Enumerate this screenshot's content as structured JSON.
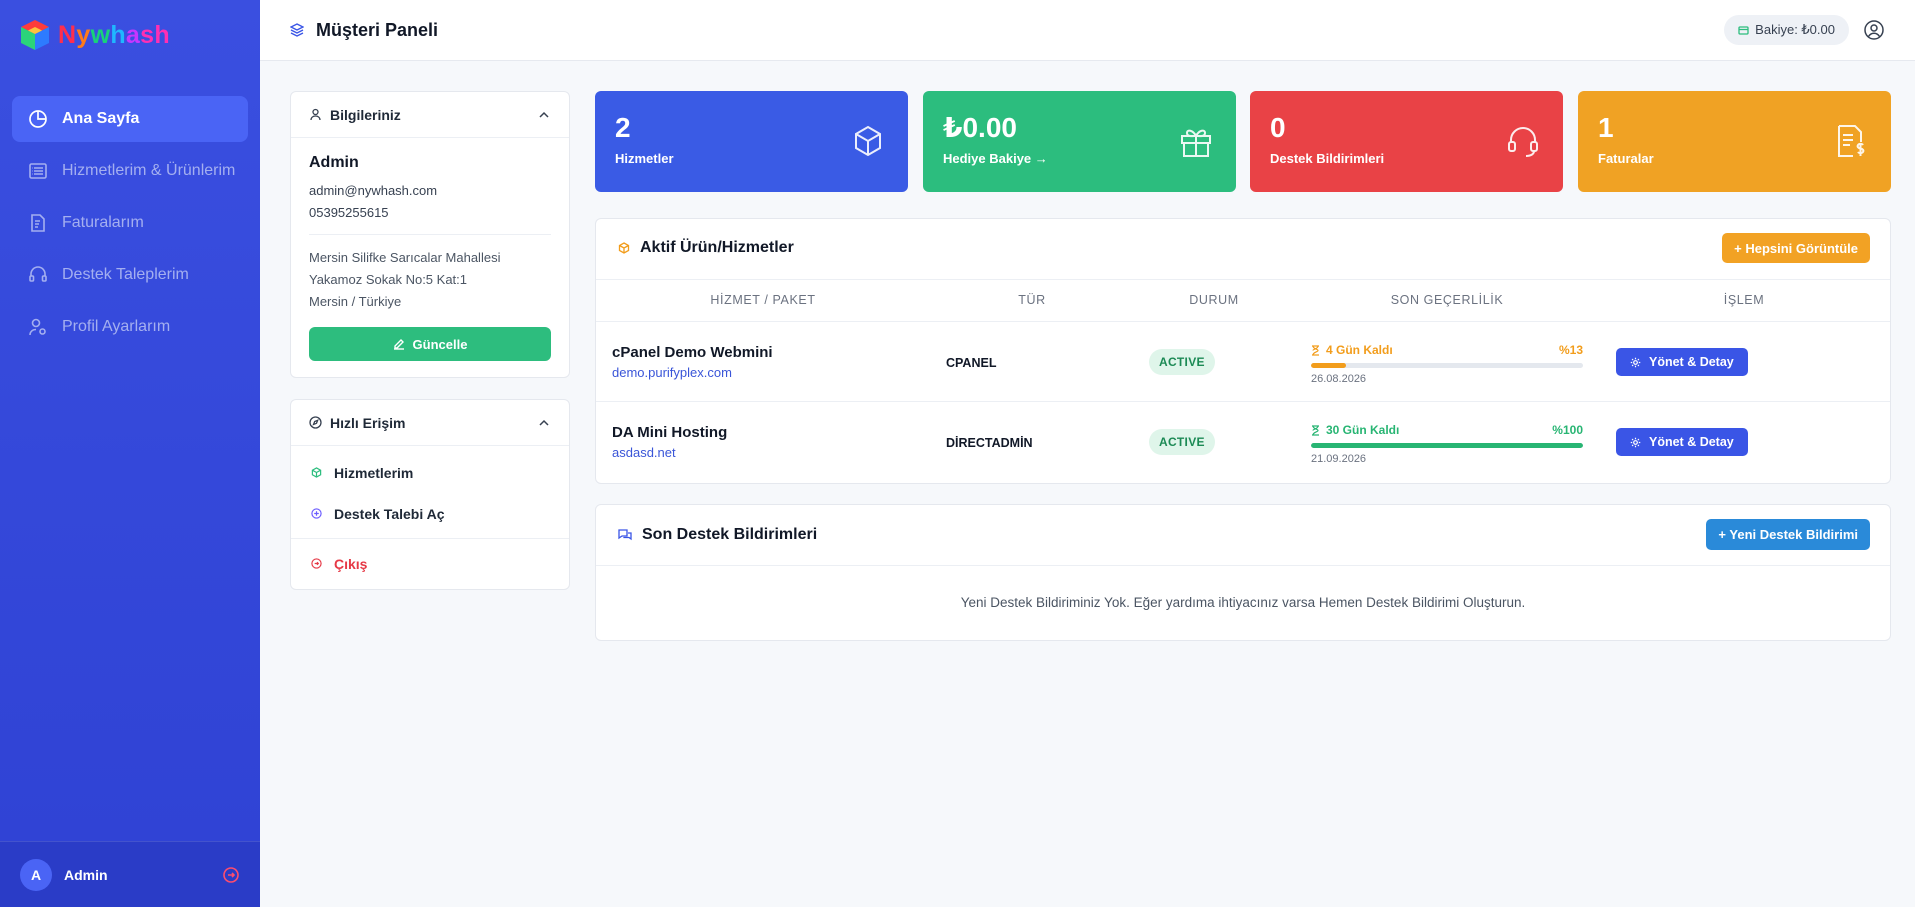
{
  "brand": {
    "name_parts": [
      "N",
      "y",
      "w",
      "h",
      "a",
      "sh"
    ]
  },
  "sidebar": {
    "items": [
      {
        "label": "Ana Sayfa",
        "icon": "pie-chart-icon",
        "active": true
      },
      {
        "label": "Hizmetlerim & Ürünlerim",
        "icon": "list-icon",
        "active": false
      },
      {
        "label": "Faturalarım",
        "icon": "invoice-icon",
        "active": false
      },
      {
        "label": "Destek Taleplerim",
        "icon": "headset-icon",
        "active": false
      },
      {
        "label": "Profil Ayarlarım",
        "icon": "user-settings-icon",
        "active": false
      }
    ],
    "footer": {
      "avatar_letter": "A",
      "user": "Admin"
    }
  },
  "topbar": {
    "title": "Müşteri Paneli",
    "balance": "Bakiye: ₺0.00"
  },
  "info_card": {
    "title": "Bilgileriniz",
    "name": "Admin",
    "email": "admin@nywhash.com",
    "phone": "05395255615",
    "address_lines": [
      "Mersin Silifke Sarıcalar Mahallesi",
      "Yakamoz Sokak No:5 Kat:1",
      "Mersin / Türkiye"
    ],
    "update_button": "Güncelle"
  },
  "quick_access": {
    "title": "Hızlı Erişim",
    "items": [
      {
        "label": "Hizmetlerim",
        "icon": "cube-icon"
      },
      {
        "label": "Destek Talebi Aç",
        "icon": "plus-circle-icon"
      },
      {
        "label": "Çıkış",
        "icon": "logout-icon"
      }
    ]
  },
  "stats": [
    {
      "value": "2",
      "label": "Hizmetler",
      "color": "#3a5be5",
      "icon": "cube-icon"
    },
    {
      "value": "₺0.00",
      "label": "Hediye Bakiye →",
      "color": "#2cbd7e",
      "icon": "gift-icon"
    },
    {
      "value": "0",
      "label": "Destek Bildirimleri",
      "color": "#e94246",
      "icon": "headset-icon"
    },
    {
      "value": "1",
      "label": "Faturalar",
      "color": "#f0a224",
      "icon": "invoice-dollar-icon"
    }
  ],
  "products": {
    "title": "Aktif Ürün/Hizmetler",
    "view_all_button": "+ Hepsini Görüntüle",
    "columns": [
      "HİZMET / PAKET",
      "TÜR",
      "DURUM",
      "SON GEÇERLİLİK",
      "İŞLEM"
    ],
    "rows": [
      {
        "name": "cPanel Demo Webmini",
        "domain": "demo.purifyplex.com",
        "type": "CPANEL",
        "status": "ACTIVE",
        "remaining": "4 Gün Kaldı",
        "percent_label": "%13",
        "percent": 13,
        "color": "#f29d1c",
        "date": "26.08.2026",
        "action": "Yönet & Detay"
      },
      {
        "name": "DA Mini Hosting",
        "domain": "asdasd.net",
        "type": "DİRECTADMİN",
        "status": "ACTIVE",
        "remaining": "30 Gün Kaldı",
        "percent_label": "%100",
        "percent": 100,
        "color": "#28b573",
        "date": "21.09.2026",
        "action": "Yönet & Detay"
      }
    ]
  },
  "support": {
    "title": "Son Destek Bildirimleri",
    "new_button": "+ Yeni Destek Bildirimi",
    "empty_message": "Yeni Destek Bildiriminiz Yok. Eğer yardıma ihtiyacınız varsa Hemen Destek Bildirimi Oluşturun."
  }
}
